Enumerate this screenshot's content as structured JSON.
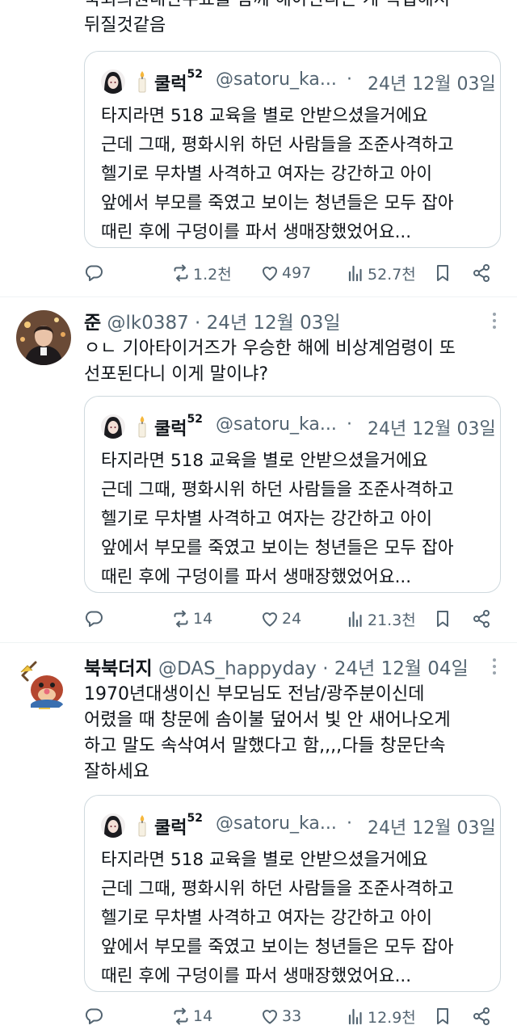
{
  "quoted": {
    "name": "쿨럭",
    "sup": "52",
    "handle": "@satoru_ka...",
    "dot": "·",
    "date": "24년 12월 03일",
    "lines": [
      "타지라면 518 교육을 별로 안받으셨을거에요",
      "근데 그때, 평화시위 하던 사람들을 조준사격하고",
      "헬기로 무차별 사격하고 여자는 강간하고 아이",
      "앞에서 부모를 죽였고 보이는 청년들은 모두 잡아",
      "때린 후에 구덩이를 파서 생매장했었어요..."
    ]
  },
  "posts": [
    {
      "text_lines": [
        "국회의원내란수표를 함께 해야한다는 게 직접해서",
        "뒤질것같음"
      ],
      "actions": {
        "reply": "",
        "retweet": "1.2천",
        "like": "497",
        "views": "52.7천"
      }
    },
    {
      "name": "준",
      "handle": "@lk0387",
      "dot": "·",
      "date": "24년 12월 03일",
      "text_lines": [
        "ㅇㄴ 기아타이거즈가 우승한 해에 비상계엄령이 또",
        "선포된다니 이게 말이냐?"
      ],
      "actions": {
        "reply": "",
        "retweet": "14",
        "like": "24",
        "views": "21.3천"
      }
    },
    {
      "name": "북북더지",
      "handle": "@DAS_happyday",
      "dot": "·",
      "date": "24년 12월 04일",
      "text_lines": [
        "1970년대생이신 부모님도 전남/광주분이신데",
        "어렸을 때 창문에 솜이불 덮어서 빛 안 새어나오게",
        "하고 말도 속삭여서 말했다고 함,,,,다들 창문단속",
        "잘하세요"
      ],
      "actions": {
        "reply": "",
        "retweet": "14",
        "like": "33",
        "views": "12.9천"
      }
    }
  ],
  "colors": {
    "text": "#0f1419",
    "muted": "#536471",
    "border": "#cfd9de"
  }
}
